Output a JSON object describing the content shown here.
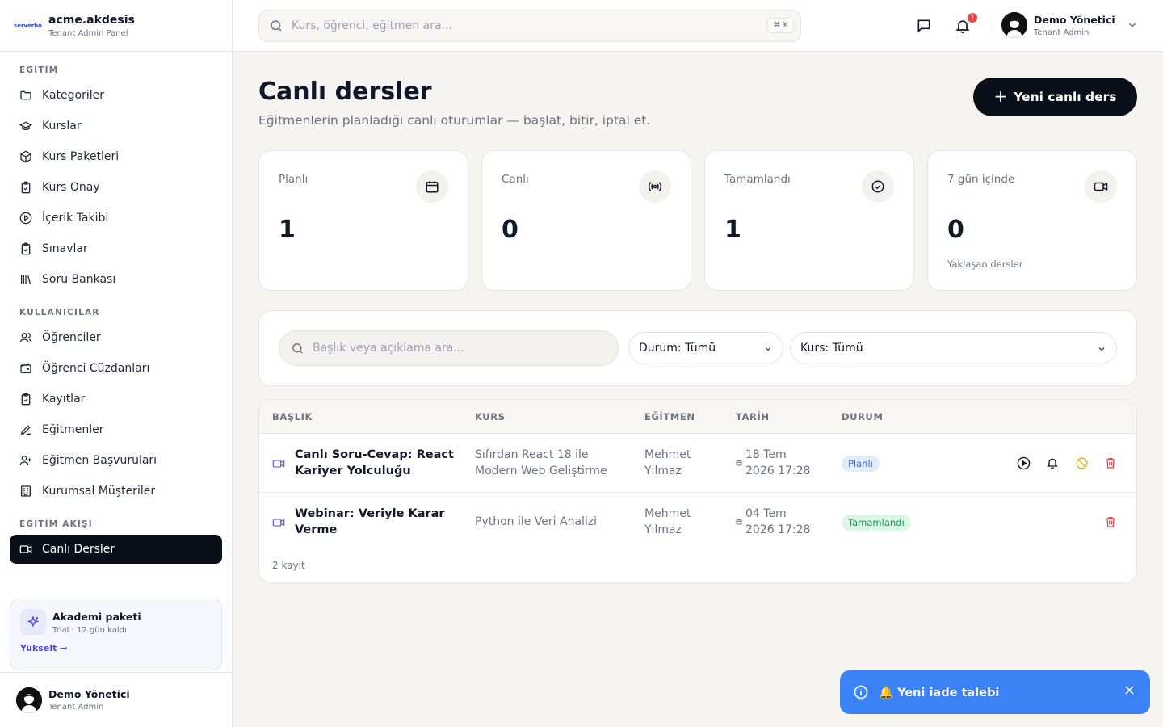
{
  "brand": {
    "logo_text": "serverbo",
    "name": "acme.akdesis",
    "subtitle": "Tenant Admin Panel"
  },
  "sidebar": {
    "sections": [
      {
        "title": "EĞİTİM",
        "items": [
          "Kategoriler",
          "Kurslar",
          "Kurs Paketleri",
          "Kurs Onay",
          "İçerik Takibi",
          "Sınavlar",
          "Soru Bankası"
        ]
      },
      {
        "title": "KULLANICILAR",
        "items": [
          "Öğrenciler",
          "Öğrenci Cüzdanları",
          "Kayıtlar",
          "Eğitmenler",
          "Eğitmen Başvuruları",
          "Kurumsal Müşteriler"
        ]
      },
      {
        "title": "EĞİTİM AKIŞI",
        "items": [
          "Canlı Dersler"
        ]
      }
    ],
    "active_item": "Canlı Dersler",
    "promo": {
      "title": "Akademi paketi",
      "subtitle": "Trial · 12 gün kaldı",
      "link": "Yükselt →"
    },
    "user": {
      "name": "Demo Yönetici",
      "role": "Tenant Admin"
    }
  },
  "topbar": {
    "search_placeholder": "Kurs, öğrenci, eğitmen ara...",
    "shortcut": "⌘ K",
    "notification_count": "1",
    "user": {
      "name": "Demo Yönetici",
      "role": "Tenant Admin"
    }
  },
  "page": {
    "title": "Canlı dersler",
    "subtitle": "Eğitmenlerin planladığı canlı oturumlar — başlat, bitir, iptal et.",
    "new_button": "Yeni canlı ders"
  },
  "stats": [
    {
      "label": "Planlı",
      "value": "1",
      "icon": "calendar-icon",
      "note": ""
    },
    {
      "label": "Canlı",
      "value": "0",
      "icon": "broadcast-icon",
      "note": ""
    },
    {
      "label": "Tamamlandı",
      "value": "1",
      "icon": "check-circle-icon",
      "note": ""
    },
    {
      "label": "7 gün içinde",
      "value": "0",
      "icon": "video-icon",
      "note": "Yaklaşan dersler"
    }
  ],
  "filters": {
    "search_placeholder": "Başlık veya açıklama ara...",
    "status": "Durum: Tümü",
    "course": "Kurs: Tümü"
  },
  "table": {
    "headers": [
      "BAŞLIK",
      "KURS",
      "EĞİTMEN",
      "TARİH",
      "DURUM"
    ],
    "rows": [
      {
        "title_l1": "Canlı Soru-Cevap: React",
        "title_l2": "Kariyer Yolculuğu",
        "course_l1": "Sıfırdan React 18 ile",
        "course_l2": "Modern Web Geliştirme",
        "instructor_l1": "Mehmet",
        "instructor_l2": "Yılmaz",
        "date_l1": "18 Tem",
        "date_l2": "2026 17:28",
        "status": "Planlı"
      },
      {
        "title_l1": "Webinar: Veriyle Karar",
        "title_l2": "Verme",
        "course_l1": "Python ile Veri Analizi",
        "course_l2": "",
        "instructor_l1": "Mehmet",
        "instructor_l2": "Yılmaz",
        "date_l1": "04 Tem",
        "date_l2": "2026 17:28",
        "status": "Tamamlandı"
      }
    ],
    "footer": "2 kayıt"
  },
  "toast": {
    "message": "🔔 Yeni iade talebi"
  },
  "colors": {
    "accent_dark": "#0b0f19",
    "toast": "#3b82f6",
    "badge": "#ef4444",
    "planned": "#3b70b8",
    "completed": "#16955a",
    "danger": "#ef4444",
    "warning": "#eab308"
  }
}
